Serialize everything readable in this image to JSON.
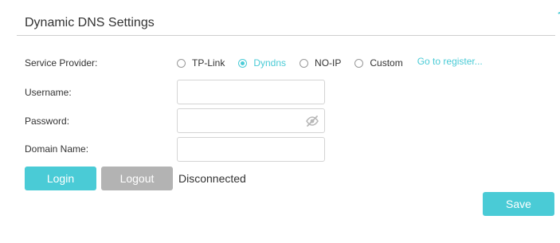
{
  "section": {
    "title": "Dynamic DNS Settings"
  },
  "service_provider": {
    "label": "Service Provider:",
    "options": [
      {
        "label": "TP-Link",
        "selected": false
      },
      {
        "label": "Dyndns",
        "selected": true
      },
      {
        "label": "NO-IP",
        "selected": false
      },
      {
        "label": "Custom",
        "selected": false
      }
    ],
    "register_link": "Go to register..."
  },
  "username": {
    "label": "Username:",
    "value": ""
  },
  "password": {
    "label": "Password:",
    "value": "",
    "visibility_icon": "eye-slash-icon"
  },
  "domain_name": {
    "label": "Domain Name:",
    "value": ""
  },
  "actions": {
    "login_label": "Login",
    "logout_label": "Logout",
    "status": "Disconnected",
    "save_label": "Save"
  },
  "colors": {
    "accent": "#4acbd6",
    "disabled": "#b3b3b3",
    "text": "#333333",
    "border": "#d4d4d4"
  }
}
